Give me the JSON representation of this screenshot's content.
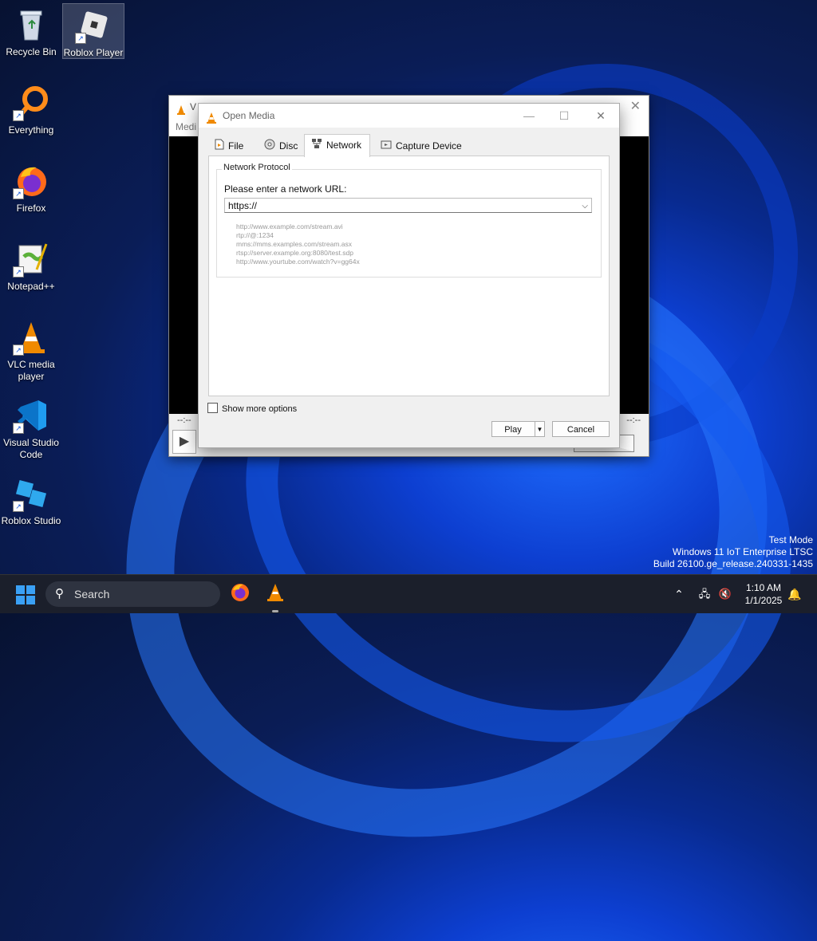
{
  "desktop": {
    "icons": [
      {
        "label": "Recycle Bin"
      },
      {
        "label": "Roblox Player"
      },
      {
        "label": "Everything"
      },
      {
        "label": "Firefox"
      },
      {
        "label": "Notepad++"
      },
      {
        "label": "VLC media player"
      },
      {
        "label": "Visual Studio Code"
      },
      {
        "label": "Roblox Studio"
      }
    ]
  },
  "vlc_main": {
    "title": "V",
    "menu": "Medi",
    "time_left": "--:--",
    "time_right": "--:--"
  },
  "dialog": {
    "title": "Open Media",
    "tabs": [
      {
        "label": "File"
      },
      {
        "label": "Disc"
      },
      {
        "label": "Network"
      },
      {
        "label": "Capture Device"
      }
    ],
    "active_tab": "Network",
    "group_label": "Network Protocol",
    "url_label": "Please enter a network URL:",
    "url_value": "https://",
    "examples": [
      "http://www.example.com/stream.avi",
      "rtp://@:1234",
      "mms://mms.examples.com/stream.asx",
      "rtsp://server.example.org:8080/test.sdp",
      "http://www.yourtube.com/watch?v=gg64x"
    ],
    "show_more": "Show more options",
    "play": "Play",
    "cancel": "Cancel"
  },
  "watermark": {
    "line1": "Test Mode",
    "line2": "Windows 11 IoT Enterprise LTSC",
    "line3": "Build 26100.ge_release.240331-1435"
  },
  "taskbar": {
    "search_placeholder": "Search",
    "time": "1:10 AM",
    "date": "1/1/2025"
  },
  "colors": {
    "accent": "#3aa0f5",
    "vlc_orange": "#f08a00",
    "taskbar": "#1b1f2b"
  }
}
